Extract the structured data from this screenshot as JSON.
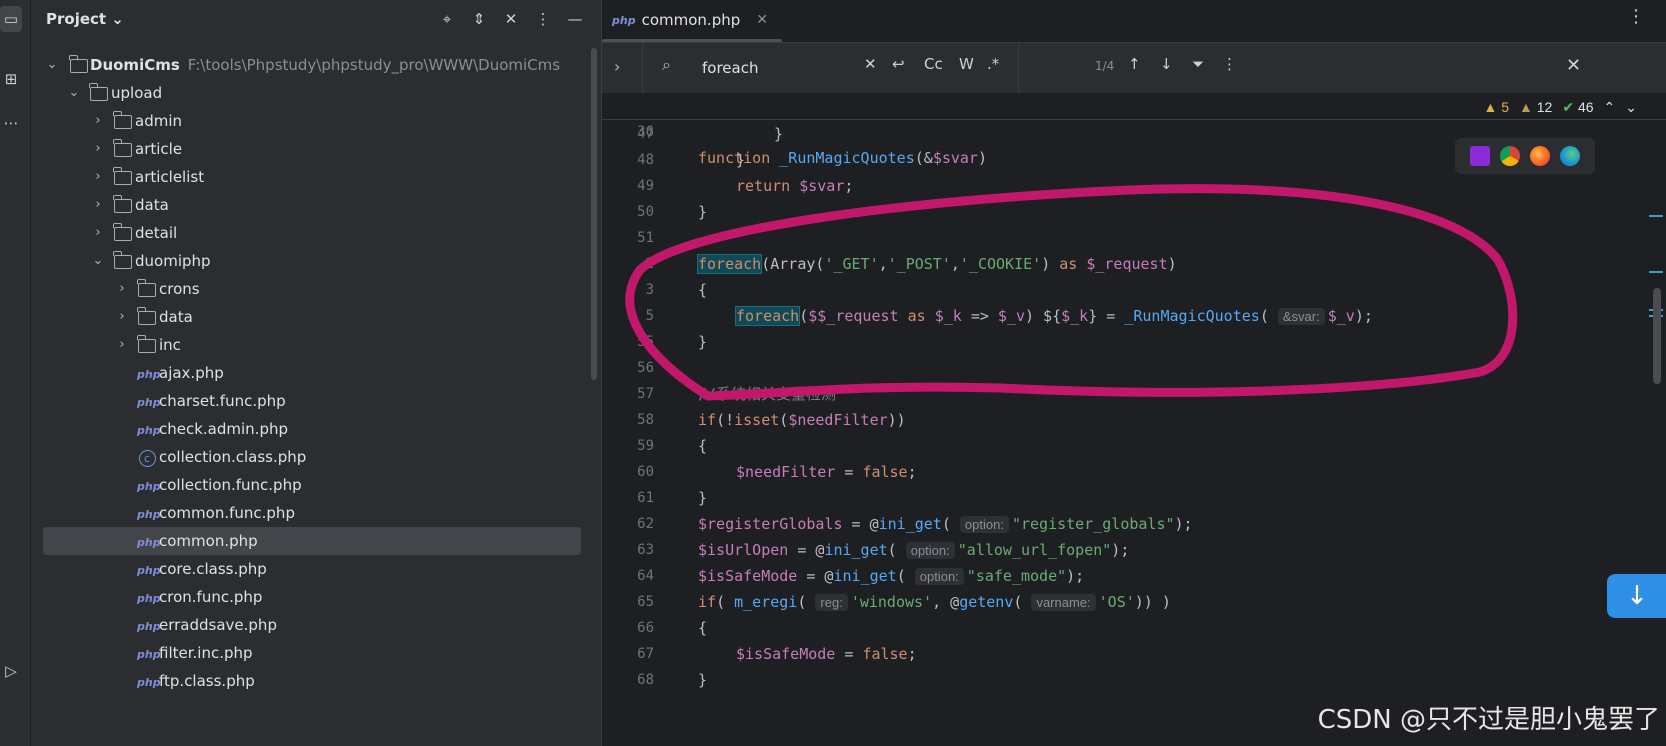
{
  "toolstrip": {
    "icons": [
      "folder-icon",
      "structure-icon",
      "more-icon",
      "services-icon"
    ]
  },
  "project": {
    "title": "Project ⌄",
    "actions": [
      "crosshair-icon",
      "expand-all-icon",
      "collapse-all-icon",
      "options-icon",
      "minimize-icon"
    ],
    "root": {
      "name": "DuomiCms",
      "path": "F:\\tools\\Phpstudy\\phpstudy_pro\\WWW\\DuomiCms"
    },
    "tree": [
      {
        "label": "upload",
        "level": 1,
        "kind": "folder",
        "open": true
      },
      {
        "label": "admin",
        "level": 2,
        "kind": "folder",
        "open": false
      },
      {
        "label": "article",
        "level": 2,
        "kind": "folder",
        "open": false
      },
      {
        "label": "articlelist",
        "level": 2,
        "kind": "folder",
        "open": false
      },
      {
        "label": "data",
        "level": 2,
        "kind": "folder",
        "open": false
      },
      {
        "label": "detail",
        "level": 2,
        "kind": "folder",
        "open": false
      },
      {
        "label": "duomiphp",
        "level": 2,
        "kind": "folder",
        "open": true
      },
      {
        "label": "crons",
        "level": 3,
        "kind": "folder",
        "open": false
      },
      {
        "label": "data",
        "level": 3,
        "kind": "folder",
        "open": false
      },
      {
        "label": "inc",
        "level": 3,
        "kind": "folder",
        "open": false
      },
      {
        "label": "ajax.php",
        "level": 3,
        "kind": "php"
      },
      {
        "label": "charset.func.php",
        "level": 3,
        "kind": "php"
      },
      {
        "label": "check.admin.php",
        "level": 3,
        "kind": "php"
      },
      {
        "label": "collection.class.php",
        "level": 3,
        "kind": "class"
      },
      {
        "label": "collection.func.php",
        "level": 3,
        "kind": "php"
      },
      {
        "label": "common.func.php",
        "level": 3,
        "kind": "php"
      },
      {
        "label": "common.php",
        "level": 3,
        "kind": "php",
        "selected": true
      },
      {
        "label": "core.class.php",
        "level": 3,
        "kind": "php"
      },
      {
        "label": "cron.func.php",
        "level": 3,
        "kind": "php"
      },
      {
        "label": "erraddsave.php",
        "level": 3,
        "kind": "php"
      },
      {
        "label": "filter.inc.php",
        "level": 3,
        "kind": "php"
      },
      {
        "label": "ftp.class.php",
        "level": 3,
        "kind": "php"
      }
    ]
  },
  "editor": {
    "tab": {
      "icon_text": "php",
      "label": "common.php"
    },
    "find": {
      "query": "foreach",
      "count": "1/4",
      "buttons": {
        "case": "Cc",
        "words": "W",
        "regex": ".*"
      }
    },
    "inspections": {
      "warnings": "5",
      "weak": "12",
      "ok": "46"
    },
    "sticky_line": {
      "num": "36"
    },
    "lines": [
      {
        "num": "47"
      },
      {
        "num": "48"
      },
      {
        "num": "49"
      },
      {
        "num": "50"
      },
      {
        "num": "51"
      },
      {
        "num": "2"
      },
      {
        "num": "3"
      },
      {
        "num": "5"
      },
      {
        "num": "55"
      },
      {
        "num": "56"
      },
      {
        "num": "57"
      },
      {
        "num": "58"
      },
      {
        "num": "59"
      },
      {
        "num": "60"
      },
      {
        "num": "61"
      },
      {
        "num": "62"
      },
      {
        "num": "63"
      },
      {
        "num": "64"
      },
      {
        "num": "65"
      },
      {
        "num": "66"
      },
      {
        "num": "67"
      },
      {
        "num": "68"
      }
    ],
    "code_text": {
      "l36": [
        "function",
        "_RunMagicQuotes",
        "(&",
        "$svar",
        ")"
      ],
      "l47": "}",
      "l48": "}",
      "l49": [
        "return",
        "$svar",
        ";"
      ],
      "l50": "}",
      "l2": [
        "foreach",
        "(Array(",
        "'_GET'",
        ",",
        "'_POST'",
        ",",
        "'_COOKIE'",
        ") ",
        "as",
        "$_request",
        ")"
      ],
      "l3": "{",
      "l5": [
        "foreach",
        "(",
        "$$_request",
        "as",
        "$_k",
        "=>",
        "$_v",
        ") ${",
        "$_k",
        "} = ",
        "_RunMagicQuotes",
        "(",
        "&svar:",
        "$_v",
        ");"
      ],
      "l55": "}",
      "l57": "//系统相关变量检测",
      "l58": [
        "if",
        "(!",
        "isset",
        "(",
        "$needFilter",
        "))"
      ],
      "l59": "{",
      "l60": [
        "$needFilter",
        " = ",
        "false",
        ";"
      ],
      "l61": "}",
      "l62": [
        "$registerGlobals",
        " = @",
        "ini_get",
        "(",
        "option:",
        "\"register_globals\"",
        ");"
      ],
      "l63": [
        "$isUrlOpen",
        " = @",
        "ini_get",
        "(",
        "option:",
        "\"allow_url_fopen\"",
        ");"
      ],
      "l64": [
        "$isSafeMode",
        " = @",
        "ini_get",
        "(",
        "option:",
        "\"safe_mode\"",
        ");"
      ],
      "l65": [
        "if",
        "( ",
        "m_eregi",
        "(",
        "reg:",
        "'windows'",
        ", @",
        "getenv",
        "(",
        "varname:",
        "'OS'",
        ")) )"
      ],
      "l66": "{",
      "l67": [
        "$isSafeMode",
        " = ",
        "false",
        ";"
      ],
      "l68": "}"
    }
  },
  "watermark": "CSDN @只不过是胆小鬼罢了",
  "colors": {
    "annotation": "#c2186b",
    "accent": "#2f8ee6"
  }
}
